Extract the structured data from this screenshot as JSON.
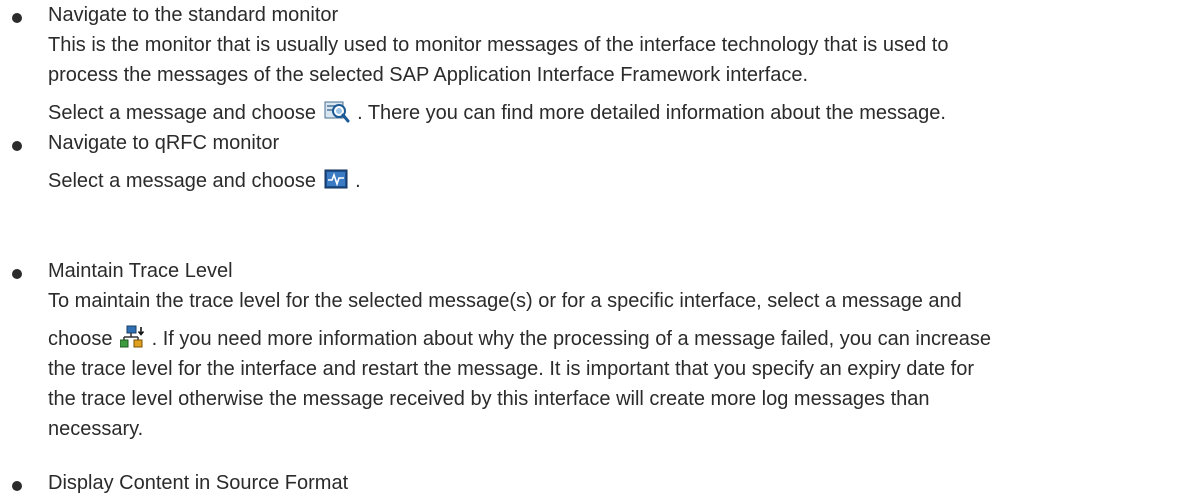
{
  "items": [
    {
      "title": "Navigate to the standard monitor",
      "desc1": "This is the monitor that is usually used to monitor messages of the interface technology that is used to",
      "desc2": "process the messages of the selected SAP Application Interface Framework interface.",
      "action_before": "Select a message and choose",
      "action_icon": "magnifier-details-icon",
      "action_after": ". There you can find more detailed information about the message."
    },
    {
      "title": "Navigate to qRFC monitor",
      "action_before": "Select a message and choose",
      "action_icon": "monitor-icon",
      "action_after": "."
    },
    {
      "title": "Maintain Trace Level",
      "desc1": "To maintain the trace level for the selected message(s) or for a specific interface, select a message and",
      "action_before": "choose",
      "action_icon": "trace-level-icon",
      "action_after": ". If you need more information about why the processing of a message failed, you can increase",
      "line3": "the trace level for the interface and restart the message. It is important that you specify an expiry date for",
      "line4": "the trace level otherwise the message received by this interface will create more log messages than",
      "line5": "necessary."
    },
    {
      "title": "Display Content in Source Format"
    }
  ]
}
